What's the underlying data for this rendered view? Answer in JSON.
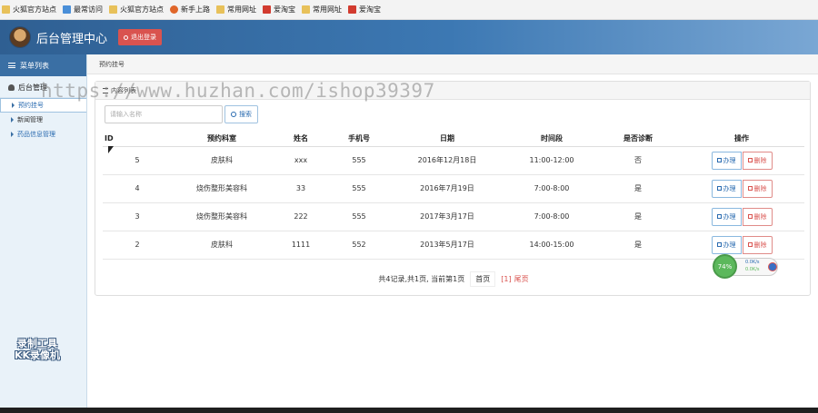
{
  "bookmarks": [
    {
      "label": "火狐官方站点",
      "icon": "folder-icon"
    },
    {
      "label": "最常访问",
      "icon": "gear-icon"
    },
    {
      "label": "火狐官方站点",
      "icon": "folder-icon"
    },
    {
      "label": "新手上路",
      "icon": "firefox-icon"
    },
    {
      "label": "常用网址",
      "icon": "folder-icon"
    },
    {
      "label": "爱淘宝",
      "icon": "taobao-icon"
    },
    {
      "label": "常用网址",
      "icon": "folder-icon"
    },
    {
      "label": "爱淘宝",
      "icon": "taobao-icon"
    }
  ],
  "header": {
    "title": "后台管理中心",
    "logout_label": "退出登录"
  },
  "sidebar": {
    "menu_title": "菜单列表",
    "group_label": "后台管理",
    "items": [
      {
        "label": "预约挂号"
      },
      {
        "label": "新闻管理"
      },
      {
        "label": "药品信息管理"
      }
    ]
  },
  "breadcrumb": "预约挂号",
  "panel": {
    "title": "内容列表",
    "search_placeholder": "请输入名称",
    "search_label": "搜索"
  },
  "table": {
    "headers": [
      "ID",
      "预约科室",
      "姓名",
      "手机号",
      "日期",
      "时间段",
      "是否诊断",
      "操作"
    ],
    "rows": [
      [
        "5",
        "皮肤科",
        "xxx",
        "555",
        "2016年12月18日",
        "11:00-12:00",
        "否"
      ],
      [
        "4",
        "烧伤整形美容科",
        "33",
        "555",
        "2016年7月19日",
        "7:00-8:00",
        "是"
      ],
      [
        "3",
        "烧伤整形美容科",
        "222",
        "555",
        "2017年3月17日",
        "7:00-8:00",
        "是"
      ],
      [
        "2",
        "皮肤科",
        "1111",
        "552",
        "2013年5月17日",
        "14:00-15:00",
        "是"
      ]
    ],
    "action_do": "办理",
    "action_delete": "删除"
  },
  "pager": {
    "summary": "共4记录,共1页, 当前第1页",
    "first": "首页",
    "current": "[1]",
    "last": "尾页"
  },
  "watermark": "https://www.huzhan.com/ishop39397",
  "recorder": {
    "line1": "录制工具",
    "line2": "KK录像机"
  },
  "speed_widget": {
    "percent": "74%",
    "up": "0.0K/s",
    "down": "0.0K/s"
  },
  "colors": {
    "header_blue": "#3c78b3",
    "danger": "#d9534f",
    "success": "#5cb85c",
    "link": "#2a6bb0"
  }
}
